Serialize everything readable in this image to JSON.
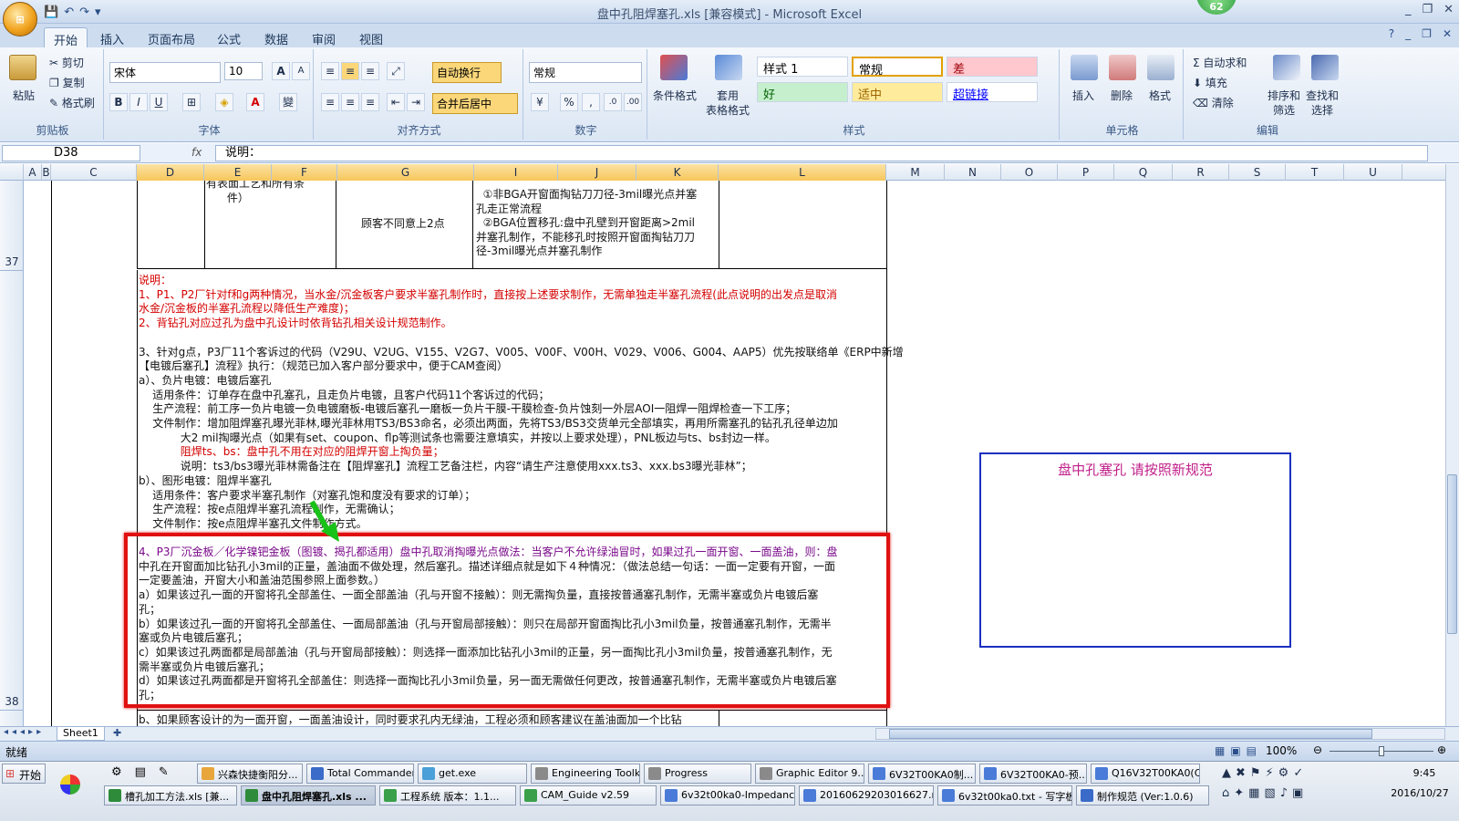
{
  "window": {
    "title": "盘中孔阻焊塞孔.xls  [兼容模式] - Microsoft Excel",
    "notification_count": "62",
    "controls": [
      "_",
      "❐",
      "✕"
    ]
  },
  "quick_access": {
    "save": "💾",
    "undo": "↶",
    "redo": "↷",
    "more": "▾"
  },
  "office_button": {
    "label": "Office"
  },
  "tabs": [
    {
      "label": "开始",
      "active": true
    },
    {
      "label": "插入"
    },
    {
      "label": "页面布局"
    },
    {
      "label": "公式"
    },
    {
      "label": "数据"
    },
    {
      "label": "审阅"
    },
    {
      "label": "视图"
    }
  ],
  "ribbon": {
    "clipboard": {
      "paste": "粘贴",
      "cut": "剪切",
      "copy": "复制",
      "format_painter": "格式刷",
      "label": "剪贴板"
    },
    "font": {
      "name": "宋体",
      "size": "10",
      "grow": "A",
      "shrink": "A",
      "bold": "B",
      "italic": "I",
      "underline": "U",
      "label": "字体",
      "phonetic": "變"
    },
    "alignment": {
      "wrap": "自动换行",
      "merge": "合并后居中",
      "label": "对齐方式"
    },
    "number": {
      "format": "常规",
      "percent": "%",
      "comma": ",",
      "label": "数字"
    },
    "styles": {
      "conditional": "条件格式",
      "table": "套用",
      "table2": "表格格式",
      "cells": [
        {
          "label": "样式 1",
          "bg": "#ffffff",
          "color": "#000000"
        },
        {
          "label": "常规",
          "bg": "#ffffff",
          "color": "#000000"
        },
        {
          "label": "差",
          "bg": "#ffc7ce",
          "color": "#9c0006"
        },
        {
          "label": "好",
          "bg": "#c6efce",
          "color": "#006100"
        },
        {
          "label": "适中",
          "bg": "#ffeb9c",
          "color": "#9c6500"
        },
        {
          "label": "超链接",
          "bg": "#ffffff",
          "color": "#0000ff"
        }
      ],
      "label": "样式"
    },
    "cells": {
      "insert": "插入",
      "delete": "删除",
      "format": "格式",
      "label": "单元格"
    },
    "editing": {
      "autosum": "自动求和",
      "fill": "填充",
      "clear": "清除",
      "sort": "排序和",
      "sort2": "筛选",
      "find": "查找和",
      "find2": "选择",
      "label": "编辑"
    }
  },
  "formula_bar": {
    "cell_ref": "D38",
    "fx": "fx",
    "formula": "说明："
  },
  "columns": [
    "A",
    "B",
    "C",
    "D",
    "E",
    "F",
    "G",
    "I",
    "J",
    "K",
    "L",
    "M",
    "N",
    "O",
    "P",
    "Q",
    "R",
    "S",
    "T",
    "U"
  ],
  "rows": [
    "37",
    "38"
  ],
  "sheet": {
    "row37": {
      "ef_text": "有表面工艺和所有条\n      件）",
      "g_text": "顾客不同意上2点",
      "i_text": "  ①非BGA开窗面掏钻刀刀径-3mil曝光点并塞\n孔走正常流程\n  ②BGA位置移孔:盘中孔壁到开窗距离>2mil\n并塞孔制作，不能移孔时按照开窗面掏钻刀刀\n径-3mil曝光点并塞孔制作"
    },
    "note_lines": [
      {
        "text": "说明：",
        "color": "red"
      },
      {
        "text": "1、P1、P2厂针对f和g两种情况，当水金/沉金板客户要求半塞孔制作时，直接按上述要求制作，无需单独走半塞孔流程(此点说明的出发点是取消",
        "color": "red"
      },
      {
        "text": "水金/沉金板的半塞孔流程以降低生产难度)；",
        "color": "red"
      },
      {
        "text": "2、背钻孔对应过孔为盘中孔设计时依背钻孔相关设计规范制作。",
        "color": "red"
      },
      {
        "text": "",
        "color": "black"
      },
      {
        "text": "3、针对g点，P3厂11个客诉过的代码（V29U、V2UG、V155、V2G7、V005、V00F、V00H、V029、V006、G004、AAP5）优先按联络单《ERP中新增",
        "color": "black"
      },
      {
        "text": "【电镀后塞孔】流程》执行：（规范已加入客户部分要求中，便于CAM查阅）",
        "color": "black"
      },
      {
        "text": "a）、负片电镀：电镀后塞孔",
        "color": "black"
      },
      {
        "text": "    适用条件：订单存在盘中孔塞孔，且走负片电镀，且客户代码11个客诉过的代码；",
        "color": "black"
      },
      {
        "text": "    生产流程：前工序一负片电镀一负电镀磨板-电镀后塞孔一磨板一负片干膜-干膜检查-负片蚀刻一外层AOI一阻焊一阻焊检查一下工序；",
        "color": "black"
      },
      {
        "text": "    文件制作：增加阻焊塞孔曝光菲林,曝光菲林用TS3/BS3命名，必须出两面，先将TS3/BS3交货单元全部填实，再用所需塞孔的钻孔孔径单边加",
        "color": "black"
      },
      {
        "text": "            大2 mil掏曝光点（如果有set、coupon、flp等测试条也需要注意填实，并按以上要求处理），PNL板边与ts、bs封边一样。",
        "color": "black"
      },
      {
        "text": "            阻焊ts、bs：盘中孔不用在对应的阻焊开窗上掏负量；",
        "color": "red"
      },
      {
        "text": "            说明：ts3/bs3曝光菲林需备注在【阻焊塞孔】流程工艺备注栏，内容“请生产注意使用xxx.ts3、xxx.bs3曝光菲林”；",
        "color": "black"
      },
      {
        "text": "b）、图形电镀：阻焊半塞孔",
        "color": "black"
      },
      {
        "text": "    适用条件：客户要求半塞孔制作（对塞孔饱和度没有要求的订单）；",
        "color": "black"
      },
      {
        "text": "    生产流程：按e点阻焊半塞孔流程制作，无需确认；",
        "color": "black"
      },
      {
        "text": "    文件制作：按e点阻焊半塞孔文件制作方式。",
        "color": "black"
      }
    ],
    "point4_lines": [
      "4、P3厂沉金板／化学镍钯金板（图镀、揭孔都适用）盘中孔取消掏曝光点做法：当客户不允许绿油冒时，如果过孔一面开窗、一面盖油，则：盘",
      "中孔在开窗面加比钻孔小3mil的正量，盖油面不做处理，然后塞孔。描述详细点就是如下４种情况：（做法总结一句话：一面一定要有开窗，一面",
      "一定要盖油，开窗大小和盖油范围参照上面参数。）",
      "a）如果该过孔一面的开窗将孔全部盖住、一面全部盖油（孔与开窗不接触）：则无需掏负量，直接按普通塞孔制作，无需半塞或负片电镀后塞",
      "孔；",
      "b）如果该过孔一面的开窗将孔全部盖住、一面局部盖油（孔与开窗局部接触）：则只在局部开窗面掏比孔小3mil负量，按普通塞孔制作，无需半",
      "塞或负片电镀后塞孔；",
      "c）如果该过孔两面都是局部盖油（孔与开窗局部接触）：则选择一面添加比钻孔小3mil的正量，另一面掏比孔小3mil负量，按普通塞孔制作，无",
      "需半塞或负片电镀后塞孔；",
      "d）如果该过孔两面都是开窗将孔全部盖住：则选择一面掏比孔小3mil负量，另一面无需做任何更改，按普通塞孔制作，无需半塞或负片电镀后塞",
      "孔；"
    ],
    "bottom_text": "b、如果顾客设计的为一面开窗，一面盖油设计，同时要求孔内无绿油，工程必须和顾客建议在盖油面加一个比钻",
    "textbox": "盘中孔塞孔  请按照新规范"
  },
  "sheet_tab": {
    "label": "Sheet1"
  },
  "status": {
    "ready": "就绪",
    "zoom": "100%"
  },
  "taskbar": {
    "start": "开始",
    "row1": [
      {
        "label": "兴森快捷衡阳分...",
        "icon": "#e8a63a"
      },
      {
        "label": "Total Commander...",
        "icon": "#3a6bc8"
      },
      {
        "label": "get.exe",
        "icon": "#4aa0d8"
      },
      {
        "label": "Engineering Toolk...",
        "icon": "#8a8a8a"
      },
      {
        "label": "Progress",
        "icon": "#8a8a8a"
      },
      {
        "label": "Graphic Editor 9....",
        "icon": "#8a8a8a"
      },
      {
        "label": "6V32T00KA0制...",
        "icon": "#4a7bd8"
      },
      {
        "label": "6V32T00KA0-预...",
        "icon": "#4a7bd8"
      },
      {
        "label": "Q16V32T00KA0(C...",
        "icon": "#4a7bd8"
      }
    ],
    "row2": [
      {
        "label": "槽孔加工方法.xls [兼...",
        "icon": "#2e8b3a"
      },
      {
        "label": "盘中孔阻焊塞孔.xls ...",
        "icon": "#2e8b3a",
        "active": true
      },
      {
        "label": "工程系统  版本：1.1...",
        "icon": "#3aa04a"
      },
      {
        "label": "CAM_Guide v2.59",
        "icon": "#3aa04a"
      },
      {
        "label": "6v32t00ka0-Impedanc...",
        "icon": "#4a7bd8"
      },
      {
        "label": "20160629203016627.r...",
        "icon": "#4a7bd8"
      },
      {
        "label": "6v32t00ka0.txt - 写字板",
        "icon": "#4a7bd8"
      },
      {
        "label": "制作规范 (Ver:1.0.6)",
        "icon": "#3a6bc8"
      }
    ],
    "time": "9:45",
    "date": "2016/10/27"
  }
}
